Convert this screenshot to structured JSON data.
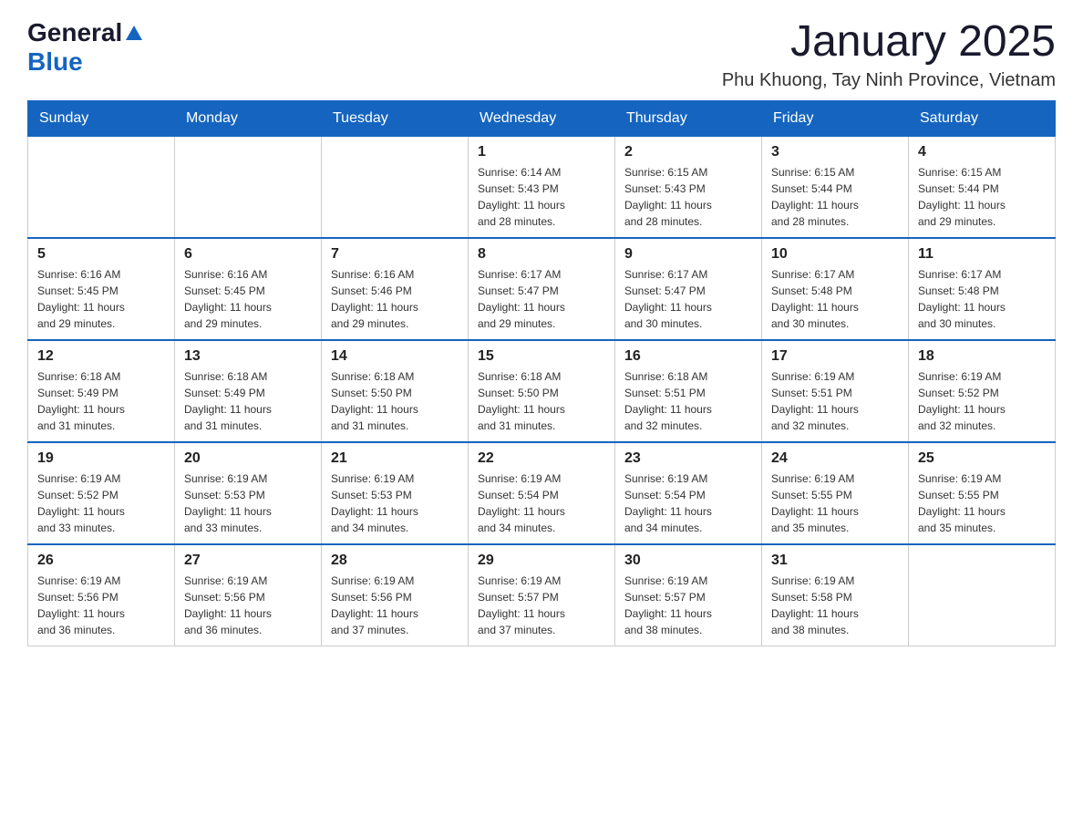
{
  "logo": {
    "general": "General",
    "blue": "Blue"
  },
  "title": "January 2025",
  "location": "Phu Khuong, Tay Ninh Province, Vietnam",
  "days_of_week": [
    "Sunday",
    "Monday",
    "Tuesday",
    "Wednesday",
    "Thursday",
    "Friday",
    "Saturday"
  ],
  "weeks": [
    [
      {
        "day": "",
        "info": ""
      },
      {
        "day": "",
        "info": ""
      },
      {
        "day": "",
        "info": ""
      },
      {
        "day": "1",
        "info": "Sunrise: 6:14 AM\nSunset: 5:43 PM\nDaylight: 11 hours\nand 28 minutes."
      },
      {
        "day": "2",
        "info": "Sunrise: 6:15 AM\nSunset: 5:43 PM\nDaylight: 11 hours\nand 28 minutes."
      },
      {
        "day": "3",
        "info": "Sunrise: 6:15 AM\nSunset: 5:44 PM\nDaylight: 11 hours\nand 28 minutes."
      },
      {
        "day": "4",
        "info": "Sunrise: 6:15 AM\nSunset: 5:44 PM\nDaylight: 11 hours\nand 29 minutes."
      }
    ],
    [
      {
        "day": "5",
        "info": "Sunrise: 6:16 AM\nSunset: 5:45 PM\nDaylight: 11 hours\nand 29 minutes."
      },
      {
        "day": "6",
        "info": "Sunrise: 6:16 AM\nSunset: 5:45 PM\nDaylight: 11 hours\nand 29 minutes."
      },
      {
        "day": "7",
        "info": "Sunrise: 6:16 AM\nSunset: 5:46 PM\nDaylight: 11 hours\nand 29 minutes."
      },
      {
        "day": "8",
        "info": "Sunrise: 6:17 AM\nSunset: 5:47 PM\nDaylight: 11 hours\nand 29 minutes."
      },
      {
        "day": "9",
        "info": "Sunrise: 6:17 AM\nSunset: 5:47 PM\nDaylight: 11 hours\nand 30 minutes."
      },
      {
        "day": "10",
        "info": "Sunrise: 6:17 AM\nSunset: 5:48 PM\nDaylight: 11 hours\nand 30 minutes."
      },
      {
        "day": "11",
        "info": "Sunrise: 6:17 AM\nSunset: 5:48 PM\nDaylight: 11 hours\nand 30 minutes."
      }
    ],
    [
      {
        "day": "12",
        "info": "Sunrise: 6:18 AM\nSunset: 5:49 PM\nDaylight: 11 hours\nand 31 minutes."
      },
      {
        "day": "13",
        "info": "Sunrise: 6:18 AM\nSunset: 5:49 PM\nDaylight: 11 hours\nand 31 minutes."
      },
      {
        "day": "14",
        "info": "Sunrise: 6:18 AM\nSunset: 5:50 PM\nDaylight: 11 hours\nand 31 minutes."
      },
      {
        "day": "15",
        "info": "Sunrise: 6:18 AM\nSunset: 5:50 PM\nDaylight: 11 hours\nand 31 minutes."
      },
      {
        "day": "16",
        "info": "Sunrise: 6:18 AM\nSunset: 5:51 PM\nDaylight: 11 hours\nand 32 minutes."
      },
      {
        "day": "17",
        "info": "Sunrise: 6:19 AM\nSunset: 5:51 PM\nDaylight: 11 hours\nand 32 minutes."
      },
      {
        "day": "18",
        "info": "Sunrise: 6:19 AM\nSunset: 5:52 PM\nDaylight: 11 hours\nand 32 minutes."
      }
    ],
    [
      {
        "day": "19",
        "info": "Sunrise: 6:19 AM\nSunset: 5:52 PM\nDaylight: 11 hours\nand 33 minutes."
      },
      {
        "day": "20",
        "info": "Sunrise: 6:19 AM\nSunset: 5:53 PM\nDaylight: 11 hours\nand 33 minutes."
      },
      {
        "day": "21",
        "info": "Sunrise: 6:19 AM\nSunset: 5:53 PM\nDaylight: 11 hours\nand 34 minutes."
      },
      {
        "day": "22",
        "info": "Sunrise: 6:19 AM\nSunset: 5:54 PM\nDaylight: 11 hours\nand 34 minutes."
      },
      {
        "day": "23",
        "info": "Sunrise: 6:19 AM\nSunset: 5:54 PM\nDaylight: 11 hours\nand 34 minutes."
      },
      {
        "day": "24",
        "info": "Sunrise: 6:19 AM\nSunset: 5:55 PM\nDaylight: 11 hours\nand 35 minutes."
      },
      {
        "day": "25",
        "info": "Sunrise: 6:19 AM\nSunset: 5:55 PM\nDaylight: 11 hours\nand 35 minutes."
      }
    ],
    [
      {
        "day": "26",
        "info": "Sunrise: 6:19 AM\nSunset: 5:56 PM\nDaylight: 11 hours\nand 36 minutes."
      },
      {
        "day": "27",
        "info": "Sunrise: 6:19 AM\nSunset: 5:56 PM\nDaylight: 11 hours\nand 36 minutes."
      },
      {
        "day": "28",
        "info": "Sunrise: 6:19 AM\nSunset: 5:56 PM\nDaylight: 11 hours\nand 37 minutes."
      },
      {
        "day": "29",
        "info": "Sunrise: 6:19 AM\nSunset: 5:57 PM\nDaylight: 11 hours\nand 37 minutes."
      },
      {
        "day": "30",
        "info": "Sunrise: 6:19 AM\nSunset: 5:57 PM\nDaylight: 11 hours\nand 38 minutes."
      },
      {
        "day": "31",
        "info": "Sunrise: 6:19 AM\nSunset: 5:58 PM\nDaylight: 11 hours\nand 38 minutes."
      },
      {
        "day": "",
        "info": ""
      }
    ]
  ]
}
